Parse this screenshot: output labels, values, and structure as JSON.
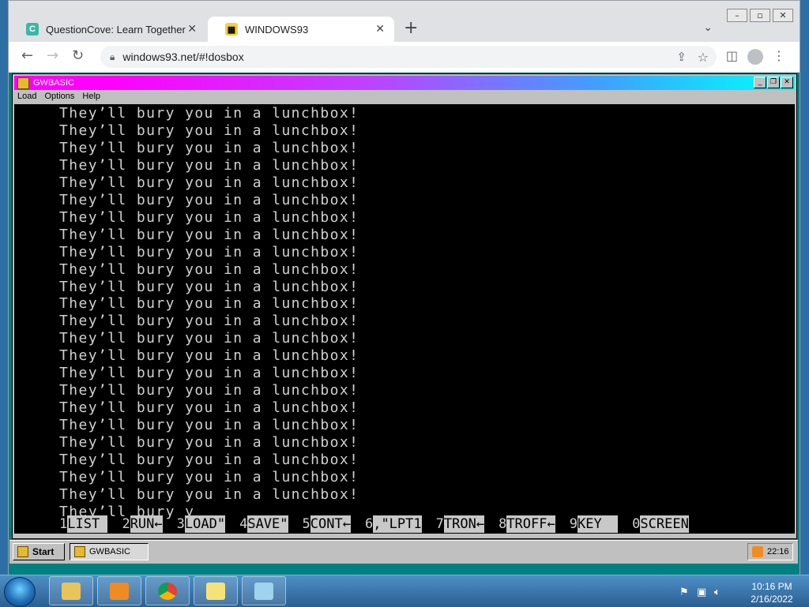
{
  "browser": {
    "tabs": [
      {
        "title": "QuestionCove: Learn Together",
        "icon": "questioncove-icon",
        "active": false
      },
      {
        "title": "WINDOWS93",
        "icon": "windows93-icon",
        "active": true
      }
    ],
    "new_tab_label": "+",
    "url": "windows93.net/#!dosbox"
  },
  "gwbasic": {
    "title": "GWBASIC",
    "menu": [
      "Load",
      "Options",
      "Help"
    ],
    "repeat_line": "They’ll bury you in a lunchbox!",
    "repeat_count": 23,
    "last_line": "They’ll bury y",
    "function_keys": [
      {
        "num": "1",
        "label": "LIST "
      },
      {
        "num": "2",
        "label": "RUN←"
      },
      {
        "num": "3",
        "label": "LOAD\""
      },
      {
        "num": "4",
        "label": "SAVE\""
      },
      {
        "num": "5",
        "label": "CONT←"
      },
      {
        "num": "6",
        "label": ",\"LPT1"
      },
      {
        "num": "7",
        "label": "TRON←"
      },
      {
        "num": "8",
        "label": "TROFF←"
      },
      {
        "num": "9",
        "label": "KEY  "
      },
      {
        "num": "0",
        "label": "SCREEN"
      }
    ]
  },
  "win93_taskbar": {
    "start_label": "Start",
    "task_label": "GWBASIC",
    "clock": "22:16"
  },
  "win7_taskbar": {
    "time": "10:16 PM",
    "date": "2/16/2022",
    "pinned": [
      {
        "name": "file-explorer-icon",
        "color": "#e9c45a"
      },
      {
        "name": "media-player-icon",
        "color": "#f08a24"
      },
      {
        "name": "chrome-icon",
        "color": "#db4437"
      },
      {
        "name": "sticky-notes-icon",
        "color": "#f7e27a"
      },
      {
        "name": "notepad-icon",
        "color": "#9fd3ee"
      }
    ]
  }
}
